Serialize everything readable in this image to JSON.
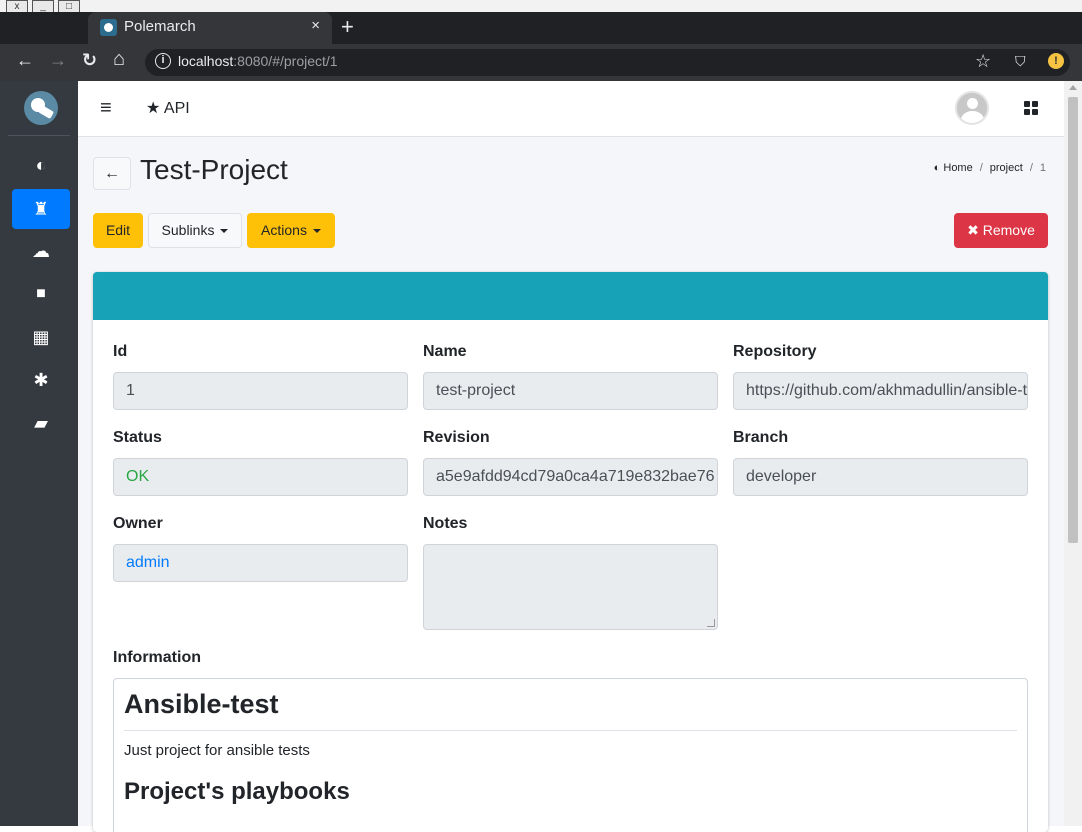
{
  "browser": {
    "tab_title": "Polemarch",
    "tab_close": "×",
    "new_tab": "+",
    "url_host": "localhost",
    "url_rest": ":8080/#/project/1",
    "info_glyph": "i",
    "star_glyph": "☆",
    "incognito_glyph": "⛉",
    "alert_glyph": "!",
    "back_glyph": "←",
    "forward_glyph": "→",
    "reload_glyph": "↻",
    "home_glyph": "⌂"
  },
  "sidebar": {
    "items": [
      {
        "icon": "dashboard-icon",
        "glyph": "◐"
      },
      {
        "icon": "projects-icon",
        "glyph": "♜"
      },
      {
        "icon": "cloud-icon",
        "glyph": "☁"
      },
      {
        "icon": "folder-icon",
        "glyph": "■"
      },
      {
        "icon": "calendar-icon",
        "glyph": "▦"
      },
      {
        "icon": "settings-icon",
        "glyph": "✱"
      },
      {
        "icon": "book-icon",
        "glyph": "▰"
      }
    ]
  },
  "topbar": {
    "menu_glyph": "≡",
    "api_glyph": "★",
    "api_label": "API"
  },
  "page": {
    "back_glyph": "←",
    "title": "Test-Project",
    "breadcrumb": {
      "home_glyph": "◐",
      "home": "Home",
      "sep": "/",
      "project": "project",
      "id": "1"
    },
    "buttons": {
      "edit": "Edit",
      "sublinks": "Sublinks",
      "actions": "Actions",
      "remove_glyph": "✖",
      "remove": "Remove"
    }
  },
  "fields": {
    "id_label": "Id",
    "id_value": "1",
    "name_label": "Name",
    "name_value": "test-project",
    "repository_label": "Repository",
    "repository_value": "https://github.com/akhmadullin/ansible-test",
    "status_label": "Status",
    "status_value": "OK",
    "revision_label": "Revision",
    "revision_value": "a5e9afdd94cd79a0ca4a719e832bae76",
    "branch_label": "Branch",
    "branch_value": "developer",
    "owner_label": "Owner",
    "owner_value": "admin",
    "notes_label": "Notes",
    "notes_value": "",
    "information_label": "Information"
  },
  "information": {
    "heading": "Ansible-test",
    "text": "Just project for ansible tests",
    "subheading": "Project's playbooks"
  },
  "colors": {
    "sidebar_bg": "#343a40",
    "sidebar_active": "#007bff",
    "card_header": "#17a2b8",
    "edit_btn": "#ffc107",
    "remove_btn": "#dc3545",
    "status_ok": "#28a745",
    "owner_link": "#007bff"
  }
}
